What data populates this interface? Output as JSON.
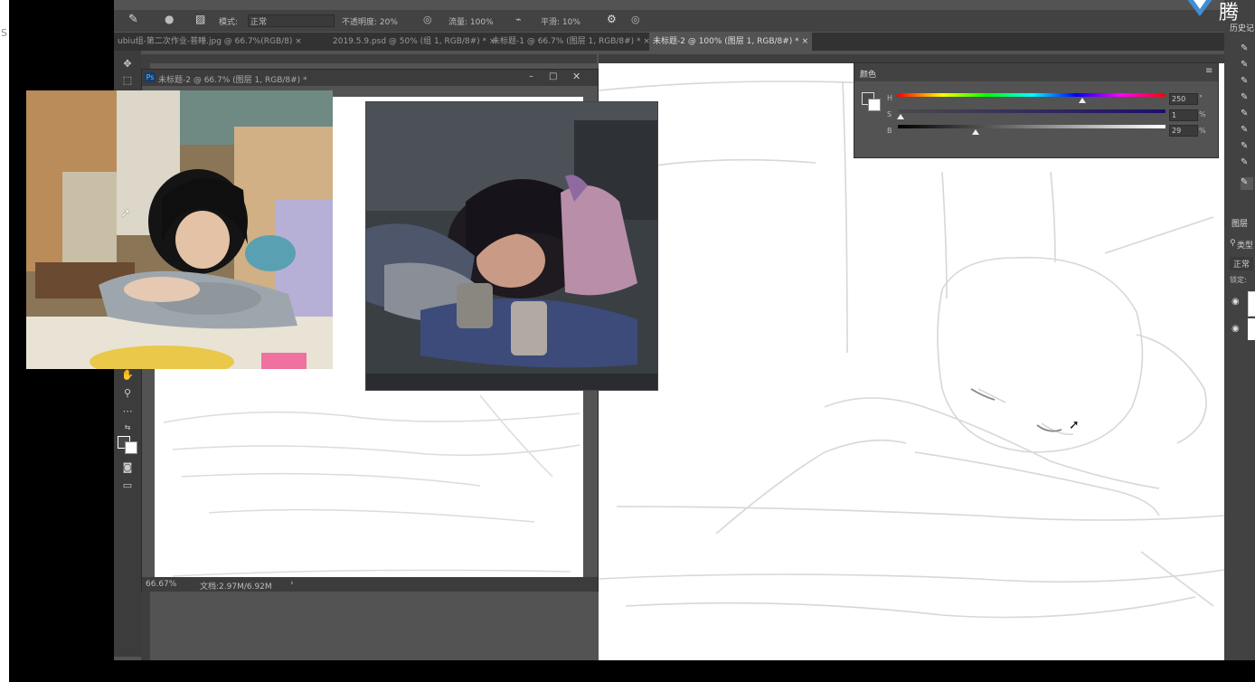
{
  "options_bar": {
    "mode_label": "模式:",
    "mode_value": "正常",
    "opacity": "不透明度: 20%",
    "flow": "流量: 100%",
    "smoothing": "平滑: 10%"
  },
  "tabs": [
    {
      "label": "ubiu组-第二次作业-普睡.jpg @ 66.7%(RGB/8)"
    },
    {
      "label": "2019.5.9.psd @ 50% (组 1, RGB/8#) *"
    },
    {
      "label": "未标题-1 @ 66.7% (图层 1, RGB/8#) *"
    },
    {
      "label": "未标题-2 @ 100% (图层 1, RGB/8#) *"
    }
  ],
  "subwindow": {
    "ps_badge": "Ps",
    "title": "未标题-2 @ 66.7% (图层 1, RGB/8#) *",
    "zoom": "66.67%",
    "doc_info": "文档:2.97M/6.92M"
  },
  "color_panel": {
    "title": "颜色",
    "h_label": "H",
    "h_value": "250",
    "h_unit": "°",
    "s_label": "S",
    "s_value": "1",
    "s_unit": "%",
    "b_label": "B",
    "b_value": "29",
    "b_unit": "%",
    "h_fraction": 0.69,
    "s_fraction": 0.01,
    "b_fraction": 0.29
  },
  "right_dock": {
    "history_label": "历史记",
    "layers_label": "图层",
    "kind_label": "类型",
    "blend_label": "正常",
    "lock_label": "锁定:"
  },
  "left_strip": {
    "letter": "S"
  },
  "top_right_logo": {
    "text": "腾"
  },
  "colors": {
    "ps_bg": "#535353",
    "panel_dark": "#424242",
    "canvas": "#ffffff"
  }
}
